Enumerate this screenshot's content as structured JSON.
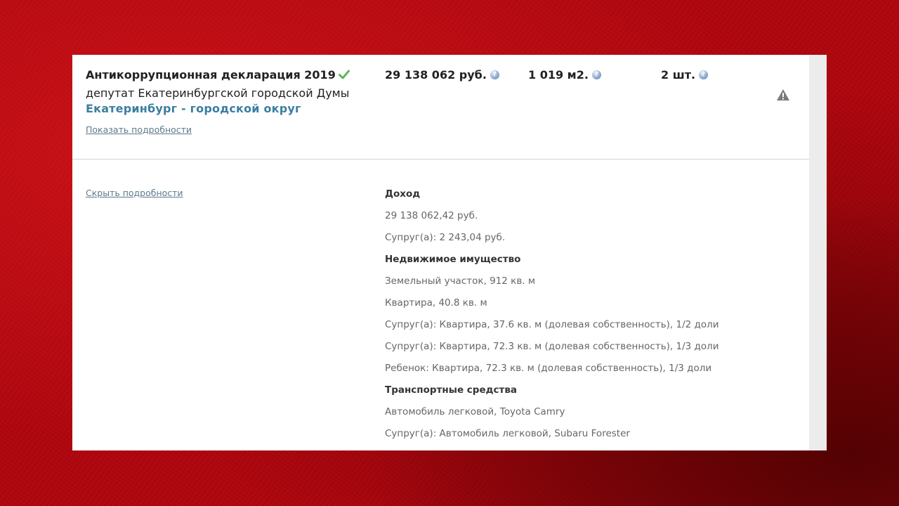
{
  "declaration": {
    "title": "Антикоррупционная декларация 2019",
    "position": "депутат Екатеринбургской городской Думы",
    "region": "Екатеринбург - городской округ",
    "show_details": "Показать подробности",
    "hide_details": "Скрыть подробности"
  },
  "summary": {
    "income": "29 138 062 руб.",
    "area": "1 019 м2.",
    "vehicles": "2 шт."
  },
  "details": {
    "income_heading": "Доход",
    "income_items": [
      "29 138 062,42 руб.",
      "Супруг(а): 2 243,04 руб."
    ],
    "realty_heading": "Недвижимое имущество",
    "realty_items": [
      "Земельный участок, 912 кв. м",
      "Квартира, 40.8 кв. м",
      "Супруг(а): Квартира, 37.6 кв. м (долевая собственность), 1/2 доли",
      "Супруг(а): Квартира, 72.3 кв. м (долевая собственность), 1/3 доли",
      "Ребенок: Квартира, 72.3 кв. м (долевая собственность), 1/3 доли"
    ],
    "transport_heading": "Транспортные средства",
    "transport_items": [
      "Автомобиль легковой, Toyota Camry",
      "Супруг(а): Автомобиль легковой, Subaru Forester"
    ]
  },
  "icons": {
    "verified": "checkmark-icon",
    "help": "help-icon",
    "warning": "warning-icon"
  },
  "colors": {
    "background": "#b1060f",
    "link": "#3b7ea0",
    "check": "#5cb85c"
  }
}
